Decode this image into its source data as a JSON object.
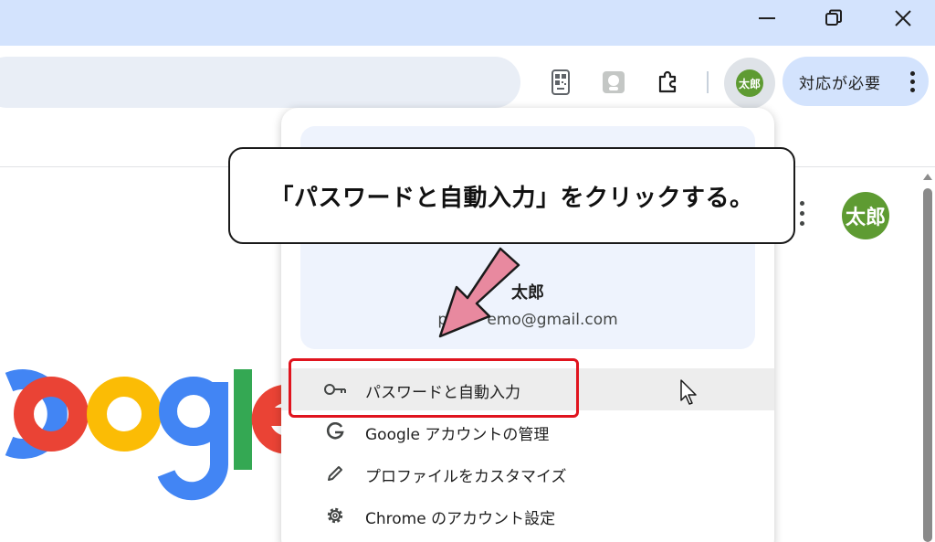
{
  "window": {
    "controls": [
      "minimize-icon",
      "maximize-icon",
      "close-icon"
    ]
  },
  "toolbar": {
    "icons": [
      "qr-code-icon",
      "profile-card-icon",
      "extensions-icon"
    ],
    "profile_avatar_text": "太郎",
    "action_button_label": "対応が必要",
    "menu_icon": "three-dots-vertical-icon"
  },
  "page": {
    "avatar_text": "太郎",
    "logo_word": "Google",
    "logo_colors": [
      "#4285f4",
      "#ea4335",
      "#fbbc05",
      "#4285f4",
      "#34a853",
      "#ea4335"
    ]
  },
  "profile_menu": {
    "name": "太郎",
    "email": "p        emo@gmail.com",
    "items": [
      {
        "label": "パスワードと自動入力",
        "icon": "key-icon",
        "highlighted": true
      },
      {
        "label": "Google アカウントの管理",
        "icon": "google-g-icon"
      },
      {
        "label": "プロファイルをカスタマイズ",
        "icon": "pencil-icon"
      },
      {
        "label": "Chrome のアカウント設定",
        "icon": "gear-icon"
      }
    ]
  },
  "annotation": {
    "callout_text": "「パスワードと自動入力」をクリックする。",
    "arrow_color": "#e8899f",
    "highlight_color": "#e0141e"
  }
}
